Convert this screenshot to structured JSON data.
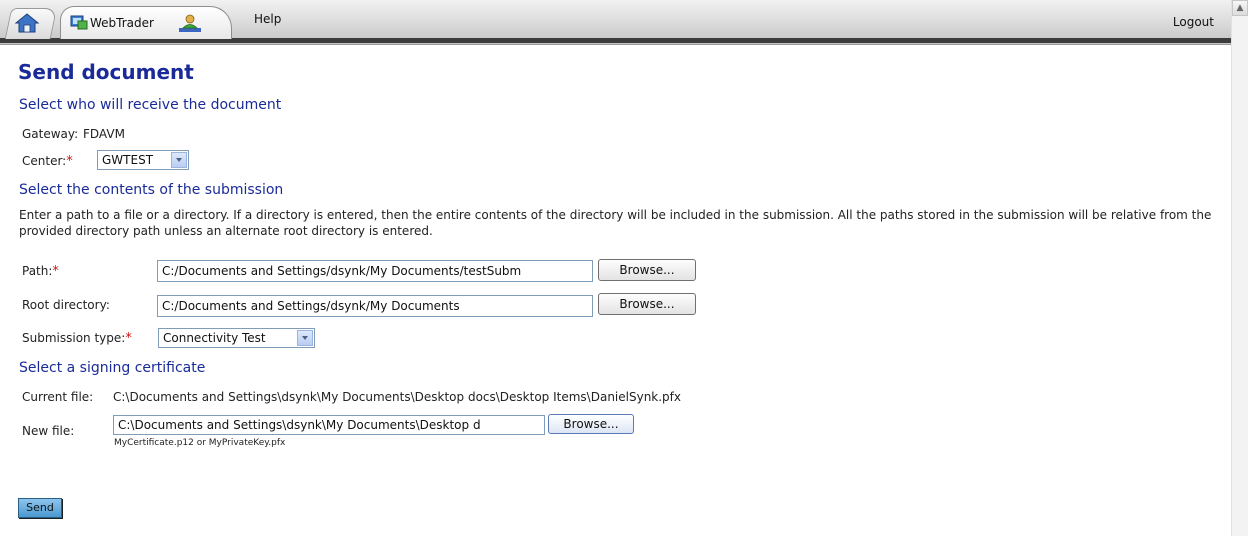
{
  "header": {
    "home_icon": "home-icon",
    "tab_label": "WebTrader",
    "tab_icon": "webtrader-icon",
    "user_icon": "user-icon",
    "help_label": "Help",
    "logout_label": "Logout"
  },
  "page": {
    "title": "Send document"
  },
  "recipient": {
    "heading": "Select who will receive the document",
    "gateway_label": "Gateway:",
    "gateway_value": "FDAVM",
    "center_label": "Center:",
    "center_value": "GWTEST"
  },
  "contents": {
    "heading": "Select the contents of the submission",
    "description": "Enter a path to a file or a directory. If a directory is entered, then the entire contents of the directory will be included in the submission. All the paths stored in the submission will be relative from the provided directory path unless an alternate root directory is entered.",
    "path_label": "Path:",
    "path_value": "C:/Documents and Settings/dsynk/My Documents/testSubm",
    "root_label": "Root directory:",
    "root_value": "C:/Documents and Settings/dsynk/My Documents",
    "browse_label": "Browse...",
    "type_label": "Submission type:",
    "type_value": "Connectivity Test"
  },
  "certificate": {
    "heading": "Select a signing certificate",
    "current_label": "Current file:",
    "current_value": "C:\\Documents and Settings\\dsynk\\My Documents\\Desktop docs\\Desktop Items\\DanielSynk.pfx",
    "new_label": "New file:",
    "new_value": "C:\\Documents and Settings\\dsynk\\My Documents\\Desktop d",
    "browse_label": "Browse...",
    "hint": "MyCertificate.p12 or MyPrivateKey.pfx"
  },
  "actions": {
    "send_label": "Send"
  },
  "required_marker": "*",
  "colors": {
    "heading": "#1a2b99",
    "required": "#d01010",
    "send_button": "#4b98d0"
  }
}
